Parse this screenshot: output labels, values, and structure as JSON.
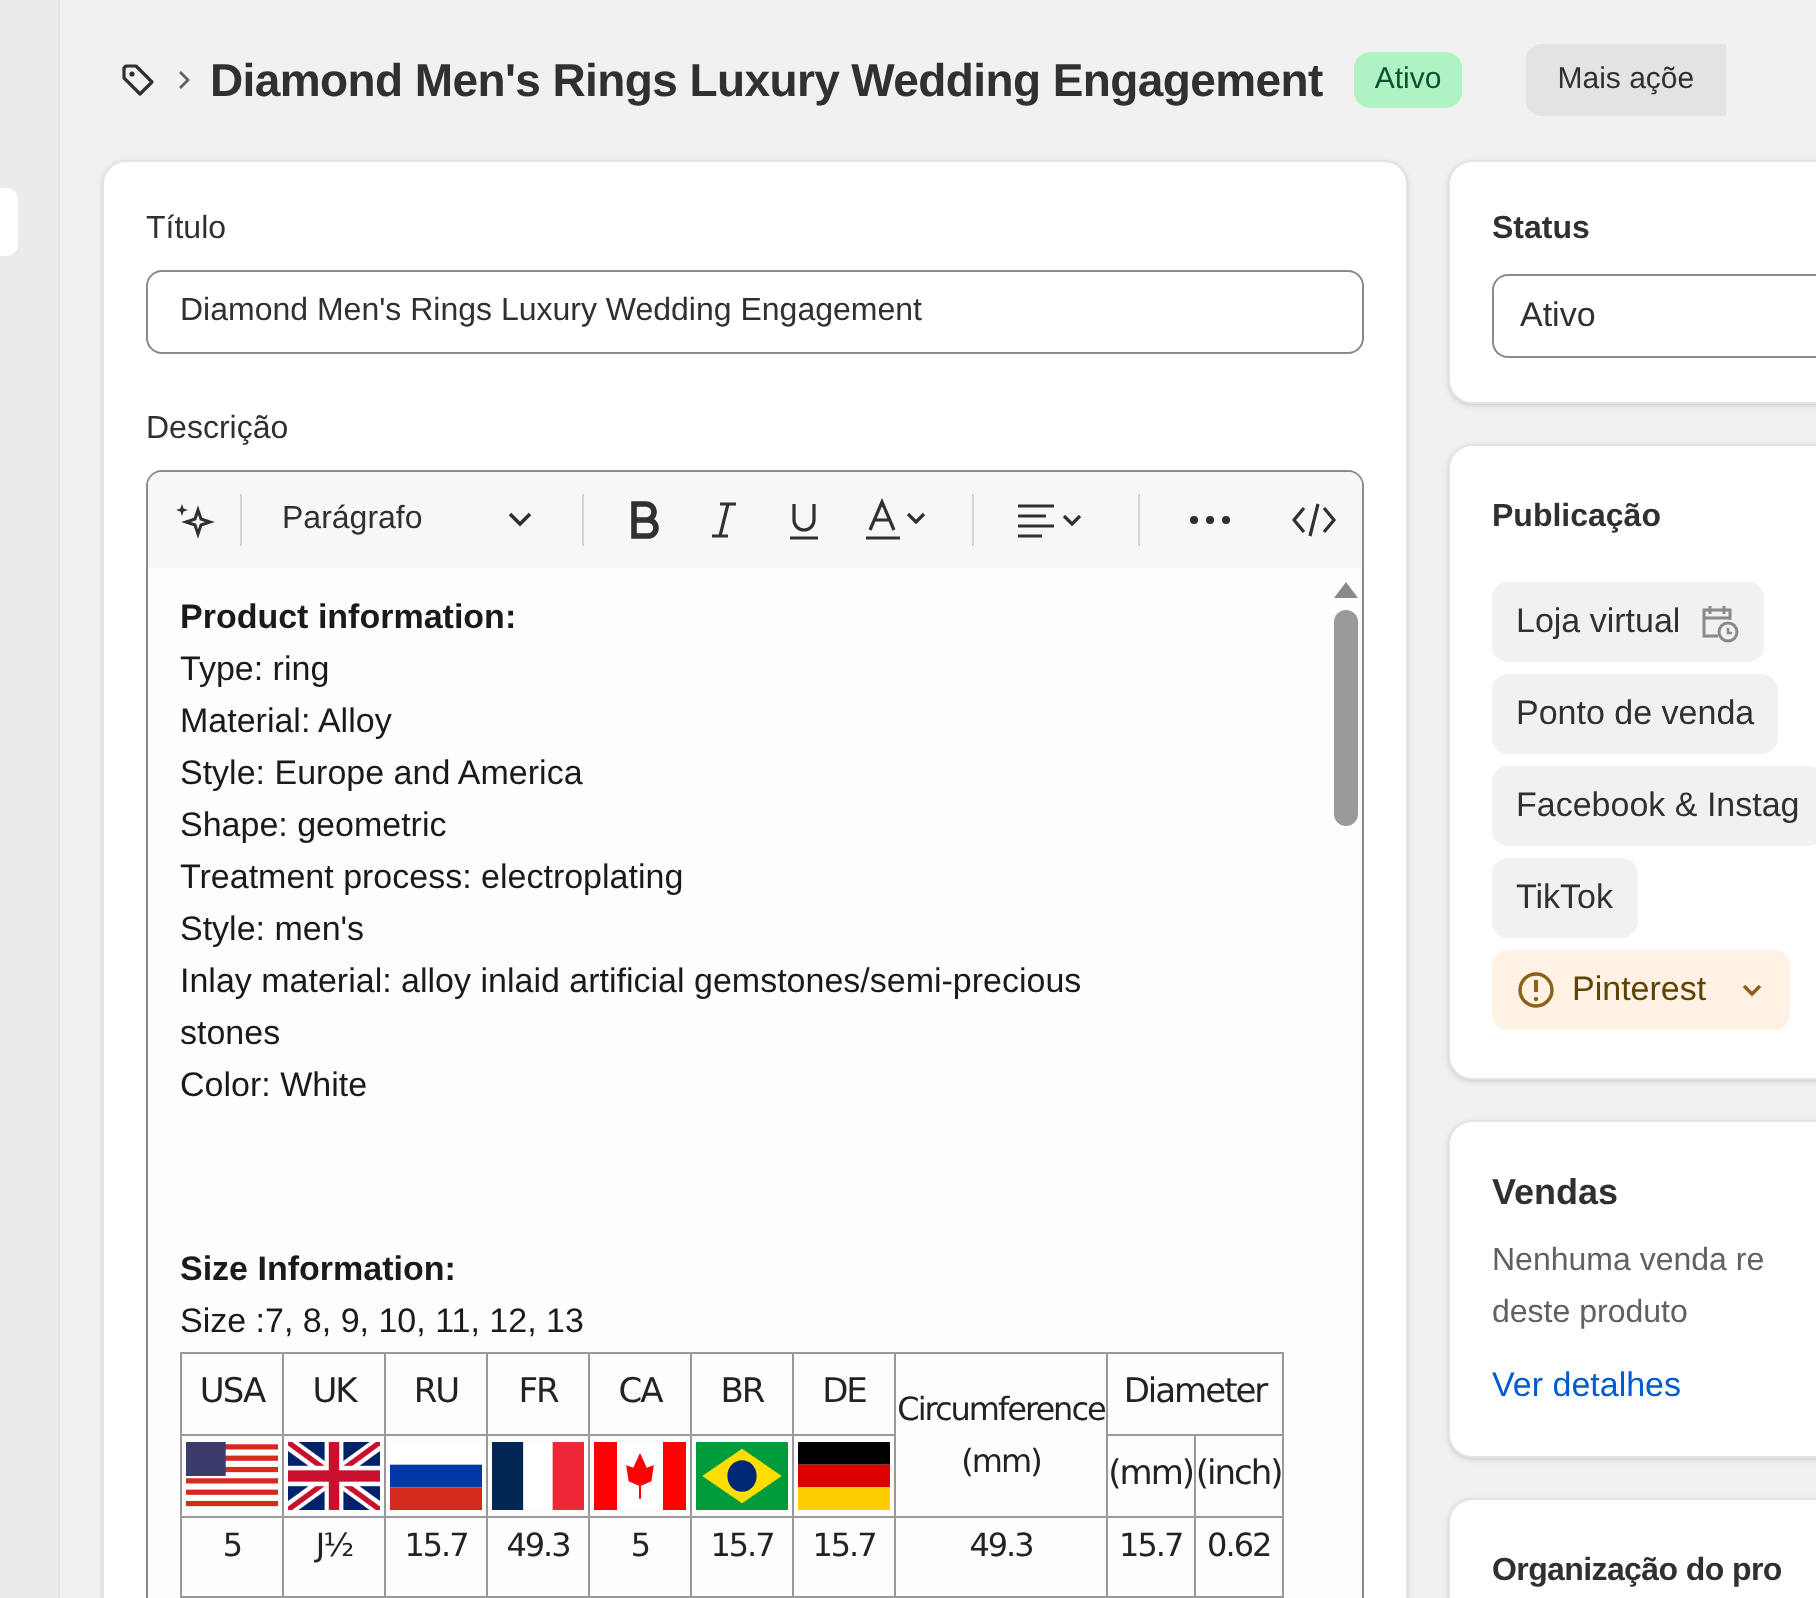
{
  "header": {
    "title": "Diamond Men's Rings Luxury Wedding Engagement",
    "status_badge": "Ativo",
    "more_actions": "Mais açõe"
  },
  "product_form": {
    "title_label": "Título",
    "title_value": "Diamond Men's Rings Luxury Wedding Engagement",
    "description_label": "Descrição",
    "toolbar": {
      "paragraph_style": "Parágrafo"
    },
    "description_lines": [
      {
        "kind": "heading",
        "text": "Product information:"
      },
      {
        "kind": "line",
        "text": "Type: ring"
      },
      {
        "kind": "line",
        "text": "Material: Alloy"
      },
      {
        "kind": "line",
        "text": "Style: Europe and America"
      },
      {
        "kind": "line",
        "text": "Shape: geometric"
      },
      {
        "kind": "line",
        "text": "Treatment process: electroplating"
      },
      {
        "kind": "line",
        "text": "Style: men's"
      },
      {
        "kind": "line",
        "text": "Inlay material: alloy inlaid artificial gemstones/semi-precious stones"
      },
      {
        "kind": "line",
        "text": "Color: White"
      },
      {
        "kind": "spacer"
      },
      {
        "kind": "heading",
        "text": "Size Information:"
      },
      {
        "kind": "line",
        "text": "Size :7, 8, 9, 10, 11, 12, 13"
      }
    ],
    "size_table": {
      "country_columns": [
        "USA",
        "UK",
        "RU",
        "FR",
        "CA",
        "BR",
        "DE"
      ],
      "circumference_header": "Circumference",
      "circumference_unit": "(mm)",
      "diameter_header": "Diameter",
      "diameter_units": [
        "(mm)",
        "(inch)"
      ],
      "rows": [
        [
          "5",
          "J½",
          "15.7",
          "49.3",
          "5",
          "15.7",
          "15.7",
          "49.3",
          "15.7",
          "0.62"
        ]
      ]
    }
  },
  "status_card": {
    "title": "Status",
    "value": "Ativo"
  },
  "publication_card": {
    "title": "Publicação",
    "channels": [
      {
        "label": "Loja virtual",
        "kind": "scheduled"
      },
      {
        "label": "Ponto de venda",
        "kind": "plain"
      },
      {
        "label": "Facebook & Instag",
        "kind": "plain"
      },
      {
        "label": "TikTok",
        "kind": "plain"
      },
      {
        "label": "Pinterest",
        "kind": "warning"
      }
    ]
  },
  "sales_card": {
    "title": "Vendas",
    "text": "Nenhuma venda re deste produto",
    "link": "Ver detalhes"
  },
  "organization_card": {
    "title": "Organização do pro"
  }
}
